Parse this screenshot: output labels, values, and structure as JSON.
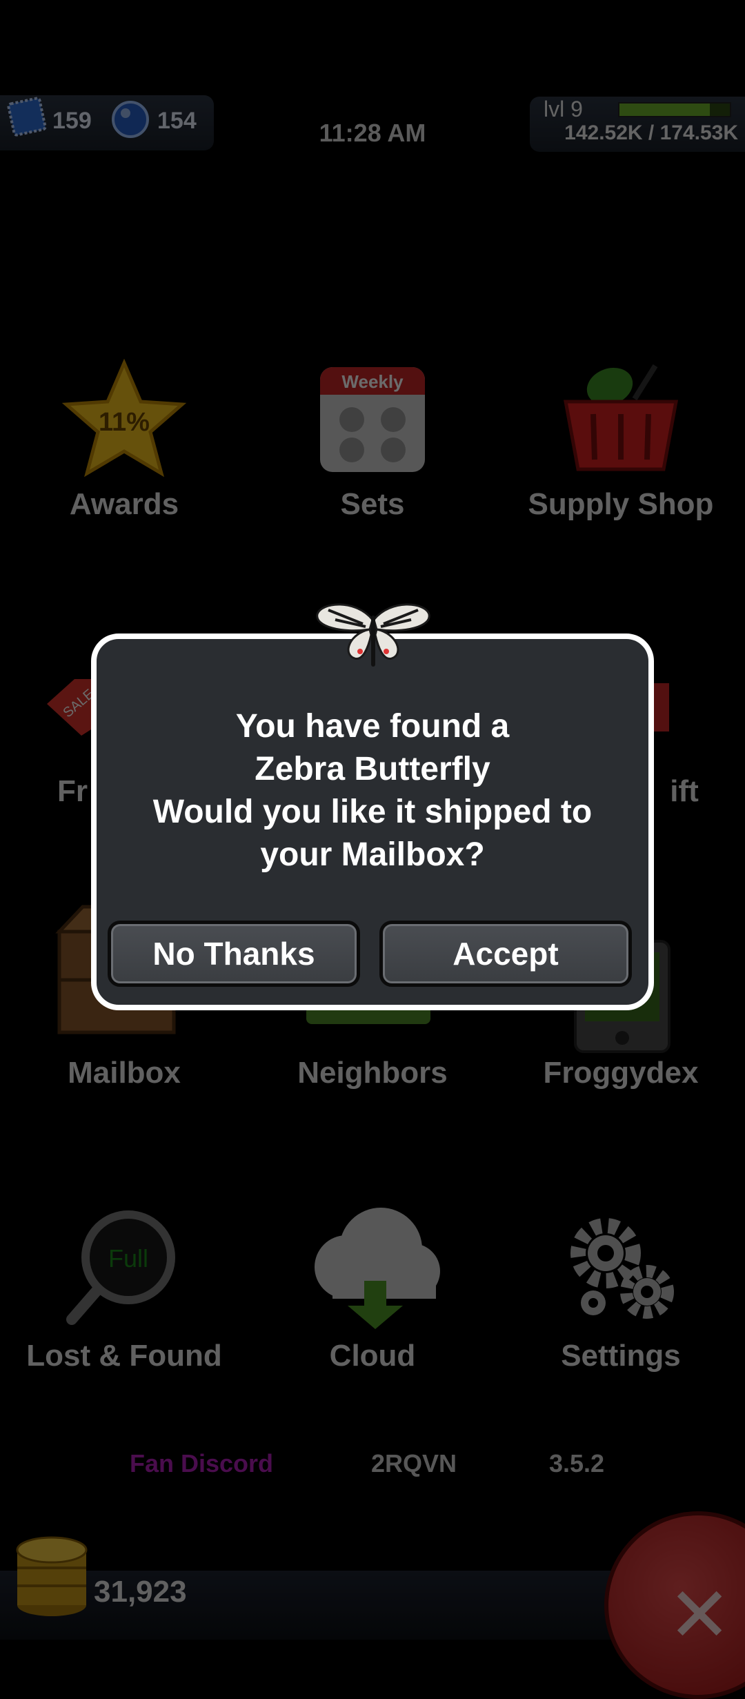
{
  "header": {
    "stamps": "159",
    "orbs": "154",
    "time": "11:28 AM",
    "level": "lvl 9",
    "xp": "142.52K / 174.53K",
    "xp_fraction": 0.817
  },
  "grid": {
    "awards": {
      "label": "Awards",
      "badge": "11%"
    },
    "sets": {
      "label": "Sets",
      "badge": "Weekly"
    },
    "supply_shop": {
      "label": "Supply Shop"
    },
    "free_partial": {
      "label": "Fr",
      "badge": "SALE"
    },
    "gift_partial": {
      "label": "ift"
    },
    "mailbox": {
      "label": "Mailbox"
    },
    "neighbors": {
      "label": "Neighbors"
    },
    "froggydex": {
      "label": "Froggydex"
    },
    "lost_found": {
      "label": "Lost & Found",
      "badge": "Full"
    },
    "cloud": {
      "label": "Cloud"
    },
    "settings": {
      "label": "Settings"
    }
  },
  "links": {
    "fan_discord": "Fan Discord",
    "code": "2RQVN",
    "version": "3.5.2"
  },
  "footer": {
    "coins": "31,923",
    "close": "✕"
  },
  "dialog": {
    "line1": "You have found a",
    "line2": "Zebra Butterfly",
    "line3": "Would you like it shipped to",
    "line4": "your Mailbox?",
    "decline": "No Thanks",
    "accept": "Accept"
  },
  "colors": {
    "fan_discord": "#b01fb8",
    "xp_fill": "#6fb42c",
    "dialog_bg": "#2a2d31",
    "close_button": "#c22424"
  }
}
